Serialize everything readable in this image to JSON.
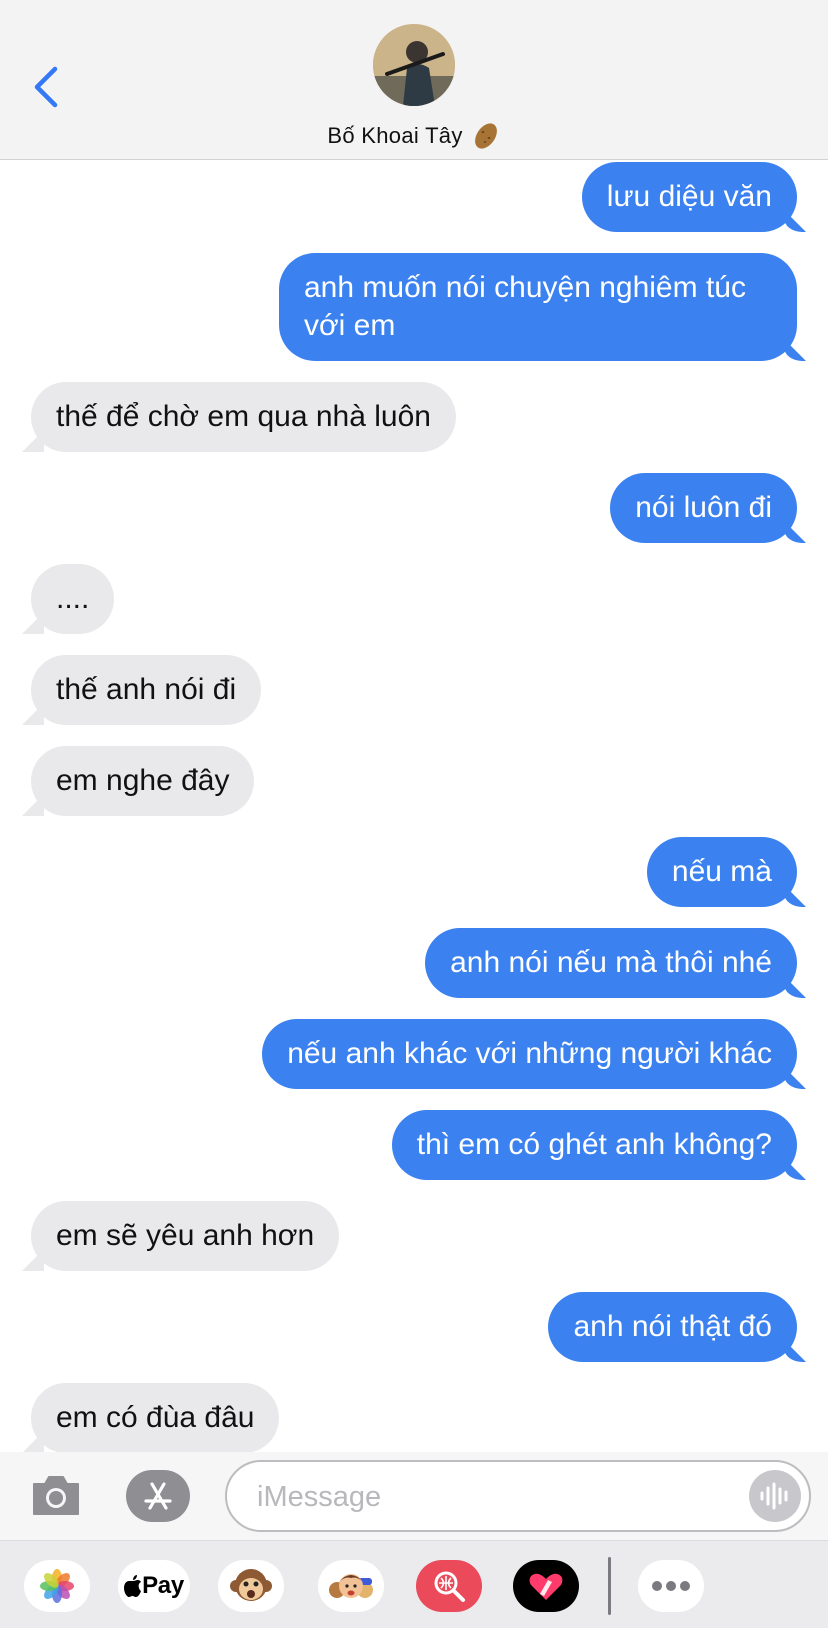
{
  "header": {
    "contact_name": "Bố Khoai Tây",
    "contact_emoji": "potato-icon",
    "back_icon": "chevron-left-icon"
  },
  "colors": {
    "outgoing_bubble": "#3b82f0",
    "incoming_bubble": "#e9e9eb",
    "accent": "#3478f6"
  },
  "messages": [
    {
      "dir": "out",
      "text": "lưu diệu văn"
    },
    {
      "dir": "out",
      "text": "anh muốn nói chuyện nghiêm túc với em"
    },
    {
      "dir": "in",
      "text": "thế để chờ em qua nhà luôn"
    },
    {
      "dir": "out",
      "text": "nói luôn đi"
    },
    {
      "dir": "in",
      "text": "...."
    },
    {
      "dir": "in",
      "text": "thế anh nói đi"
    },
    {
      "dir": "in",
      "text": "em nghe đây"
    },
    {
      "dir": "out",
      "text": "nếu mà"
    },
    {
      "dir": "out",
      "text": "anh nói nếu mà thôi nhé"
    },
    {
      "dir": "out",
      "text": "nếu anh khác với những người khác"
    },
    {
      "dir": "out",
      "text": "thì em có ghét anh không?"
    },
    {
      "dir": "in",
      "text": "em sẽ yêu anh hơn"
    },
    {
      "dir": "out",
      "text": "anh nói thật đó"
    },
    {
      "dir": "in",
      "text": "em có đùa đâu"
    }
  ],
  "composer": {
    "placeholder": "iMessage",
    "camera_icon": "camera-icon",
    "apps_icon": "app-store-icon",
    "voice_icon": "waveform-icon"
  },
  "tray": {
    "apps": [
      "photos-icon",
      "apple-pay-icon",
      "monkey-emoji-icon",
      "memoji-icon",
      "image-search-icon",
      "digital-touch-icon",
      "more-icon"
    ],
    "pay_label": "Pay"
  }
}
